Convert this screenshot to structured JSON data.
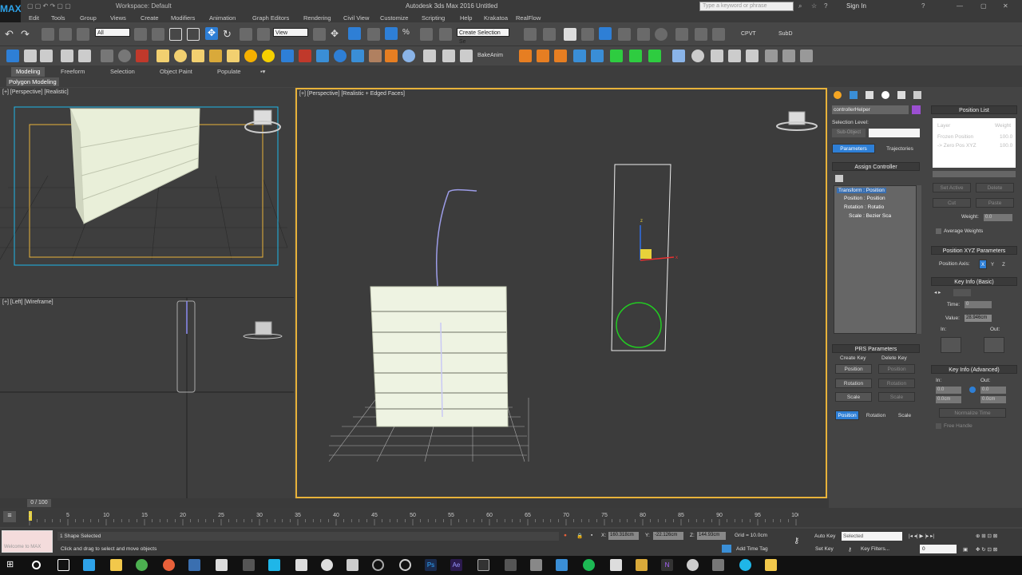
{
  "app": {
    "logo_label": "MAX",
    "workspace": "Workspace: Default",
    "title": "Autodesk 3ds Max 2016    Untitled",
    "search_placeholder": "Type a keyword or phrase",
    "sign_in": "Sign In"
  },
  "menu": [
    "Edit",
    "Tools",
    "Group",
    "Views",
    "Create",
    "Modifiers",
    "Animation",
    "Graph Editors",
    "Rendering",
    "Civil View",
    "Customize",
    "Scripting",
    "Help",
    "Krakatoa",
    "RealFlow"
  ],
  "toolbar": {
    "selection_filter": "All",
    "ref_coord": "View",
    "create_selection_set": "Create Selection Se",
    "cpvt_label": "CPVT",
    "subd_label": "SubD",
    "bakeanim_label": "BakeAnim"
  },
  "ribbon": {
    "tabs": [
      "Modeling",
      "Freeform",
      "Selection",
      "Object Paint",
      "Populate"
    ],
    "active_tab": "Modeling",
    "panel_label": "Polygon Modeling"
  },
  "viewports": {
    "top_left": "[+] [Perspective] [Realistic]",
    "bottom_left": "[+] [Left] [Wireframe]",
    "main": "[+] [Perspective] [Realistic + Edged Faces]",
    "viewcube_left": "LEFT"
  },
  "command_panel": {
    "object_name": "controllerHelper",
    "selection_level": "Selection Level:",
    "sub_object": "Sub-Object",
    "parameters_btn": "Parameters",
    "trajectories_btn": "Trajectories",
    "assign_controller": "Assign Controller",
    "tree": [
      "Transform : Position",
      "Position : Position",
      "Rotation : Rotatio",
      "Scale : Bezier Sca"
    ],
    "prs_title": "PRS Parameters",
    "create_key": "Create Key",
    "delete_key": "Delete Key",
    "position": "Position",
    "rotation": "Rotation",
    "scale": "Scale"
  },
  "motion_panel": {
    "position_list": "Position List",
    "layer_header": "Layer",
    "weight_header": "Weight",
    "layer_rows": [
      {
        "name": "Frozen Position",
        "weight": "100.0"
      },
      {
        "name": "-> Zero Pos XYZ",
        "weight": "100.0"
      }
    ],
    "set_active": "Set Active",
    "delete": "Delete",
    "cut": "Cut",
    "paste": "Paste",
    "weight_label": "Weight:",
    "weight_value": "0.0",
    "average_weights": "Average Weights",
    "pos_xyz_title": "Position XYZ Parameters",
    "position_axis": "Position Axis:",
    "axes": [
      "X",
      "Y",
      "Z"
    ],
    "key_info_basic": "Key Info (Basic)",
    "time_label": "Time:",
    "time_value": "0",
    "value_label": "Value:",
    "value_value": "28.946cm",
    "in_label": "In:",
    "out_label": "Out:",
    "key_info_advanced": "Key Info (Advanced)",
    "adv_in": "In:",
    "adv_out": "Out:",
    "adv_in_val": "0.0",
    "adv_out_val": "0.0",
    "adv_in_val2": "0.0cm",
    "adv_out_val2": "0.0cm",
    "normalize_time": "Normalize Time",
    "free_handle": "Free Handle"
  },
  "timeline": {
    "frame_counter": "0 / 100",
    "ticks": [
      "0",
      "5",
      "10",
      "15",
      "20",
      "25",
      "30",
      "35",
      "40",
      "45",
      "50",
      "55",
      "60",
      "65",
      "70",
      "75",
      "80",
      "85",
      "90",
      "95",
      "100"
    ]
  },
  "status": {
    "maxscript": "Welcome to MAX",
    "selected": "1 Shape Selected",
    "prompt": "Click and drag to select and move objects",
    "x_label": "X:",
    "x_value": "160.318cm",
    "y_label": "Y:",
    "y_value": "-22.126cm",
    "z_label": "Z:",
    "z_value": "144.93cm",
    "grid": "Grid = 10.0cm",
    "add_time_tag": "Add Time Tag",
    "auto_key": "Auto Key",
    "selected_dropdown": "Selected",
    "set_key": "Set Key",
    "key_filters": "Key Filters...",
    "current_frame": "0"
  },
  "colors": {
    "accent": "#2e7fd6",
    "active_viewport_border": "#e8b23a",
    "camera_frame": "#1fb6e8",
    "wall": "#e9efd9",
    "helper_circle": "#22cc22",
    "object_color_swatch": "#9b4fd1"
  }
}
